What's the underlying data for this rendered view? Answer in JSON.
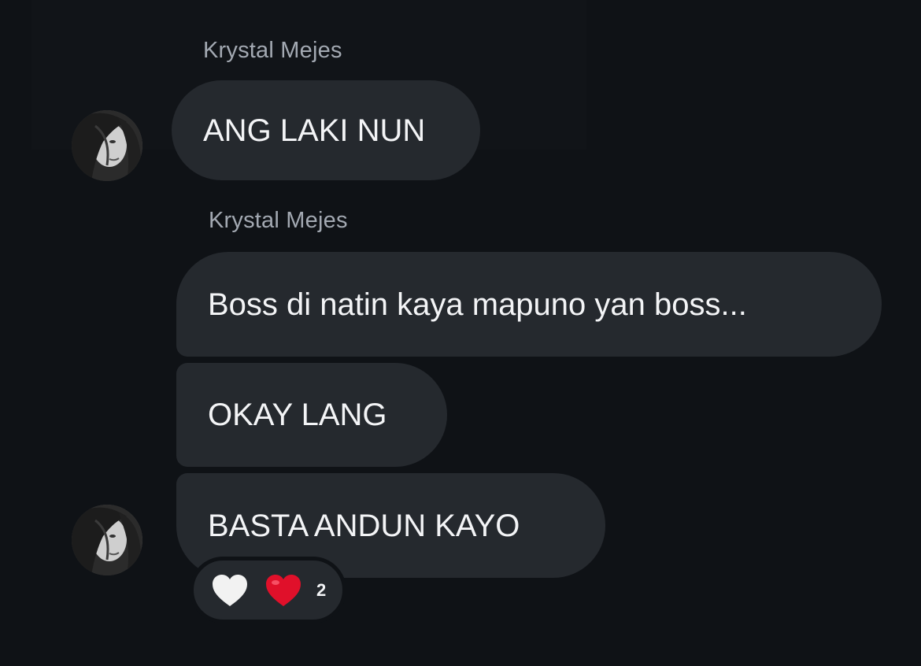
{
  "messages": [
    {
      "sender": "Krystal Mejes",
      "text": "ANG LAKI NUN"
    },
    {
      "sender": "Krystal Mejes",
      "text": "Boss di natin kaya mapuno yan boss..."
    },
    {
      "text": "OKAY LANG"
    },
    {
      "text": "BASTA ANDUN KAYO"
    }
  ],
  "reactions": {
    "icons": [
      "white-heart-icon",
      "red-heart-icon"
    ],
    "count": "2"
  },
  "colors": {
    "background": "#0f1216",
    "bubble": "#25292e",
    "sender_text": "#a3a9b2",
    "message_text": "#f3f4f6",
    "heart_red": "#e0102a",
    "heart_white": "#f2f2f2"
  }
}
